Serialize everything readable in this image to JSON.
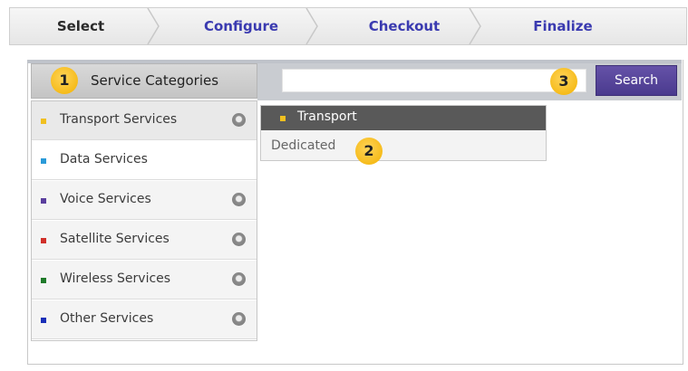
{
  "wizard": {
    "steps": [
      {
        "label": "Select",
        "active": true
      },
      {
        "label": "Configure",
        "active": false
      },
      {
        "label": "Checkout",
        "active": false
      },
      {
        "label": "Finalize",
        "active": false
      }
    ]
  },
  "categories_header": "Service Categories",
  "search": {
    "value": "",
    "placeholder": "",
    "button_label": "Search"
  },
  "categories": [
    {
      "label": "Transport Services",
      "bullet_color": "#f0c020",
      "has_submenu": true
    },
    {
      "label": "Data Services",
      "bullet_color": "#2a9ad8",
      "has_submenu": false
    },
    {
      "label": "Voice Services",
      "bullet_color": "#5a3f9e",
      "has_submenu": true
    },
    {
      "label": "Satellite Services",
      "bullet_color": "#d0302a",
      "has_submenu": true
    },
    {
      "label": "Wireless Services",
      "bullet_color": "#1f7a2a",
      "has_submenu": true
    },
    {
      "label": "Other Services",
      "bullet_color": "#1a2fb8",
      "has_submenu": true
    }
  ],
  "flyout": {
    "title": "Transport",
    "title_bullet_color": "#f0c020",
    "items": [
      "Dedicated"
    ]
  },
  "callouts": [
    "1",
    "2",
    "3"
  ],
  "colors": {
    "accent": "#4a3a8e",
    "link": "#3a3ab0",
    "marker": "#f2b100"
  }
}
